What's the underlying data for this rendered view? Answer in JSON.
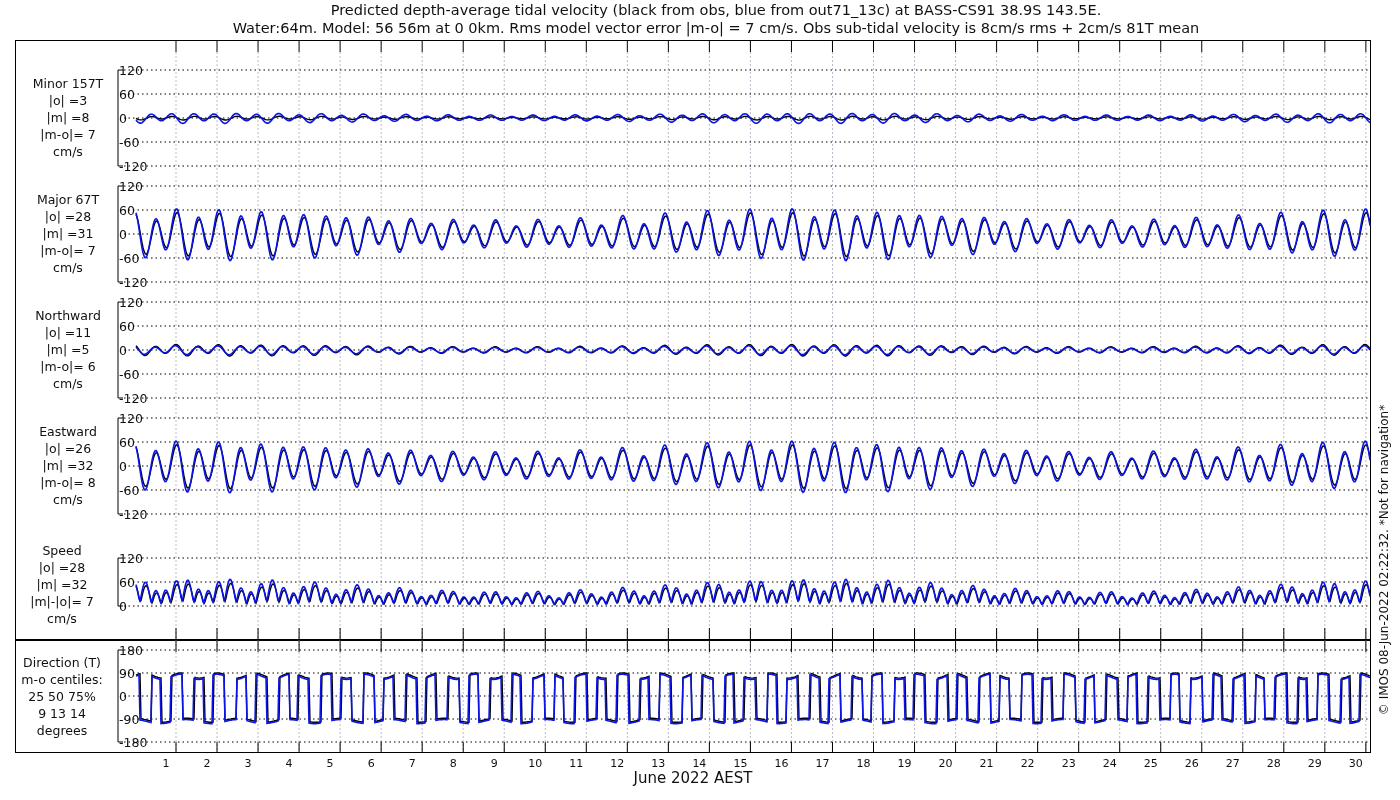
{
  "title_lines": [
    "Predicted depth-average tidal velocity (black from obs, blue from out71_13c) at BASS-CS91 38.9S 143.5E.",
    "Water:64m. Model: 56 56m at 0 0km. Rms model vector error |m-o| = 7 cm/s. Obs sub-tidal velocity is 8cm/s rms + 2cm/s 81T mean"
  ],
  "panels": [
    {
      "kind": "minor",
      "label_lines": [
        "Minor 157T",
        "|o| =3",
        "|m| =8",
        "|m-o|= 7",
        "cm/s"
      ],
      "yticks": [
        "120",
        "60",
        "0",
        "-60",
        "-120"
      ]
    },
    {
      "kind": "major",
      "label_lines": [
        "Major 67T",
        "|o| =28",
        "|m| =31",
        "|m-o|= 7",
        "cm/s"
      ],
      "yticks": [
        "120",
        "60",
        "0",
        "-60",
        "-120"
      ]
    },
    {
      "kind": "northward",
      "label_lines": [
        "Northward",
        "|o| =11",
        "|m| =5",
        "|m-o|= 6",
        "cm/s"
      ],
      "yticks": [
        "120",
        "60",
        "0",
        "-60",
        "-120"
      ]
    },
    {
      "kind": "eastward",
      "label_lines": [
        "Eastward",
        "|o| =26",
        "|m| =32",
        "|m-o|= 8",
        "cm/s"
      ],
      "yticks": [
        "120",
        "60",
        "0",
        "-60",
        "-120"
      ]
    },
    {
      "kind": "speed",
      "label_lines": [
        "Speed",
        "|o| =28",
        "|m| =32",
        "|m|-|o|= 7",
        "cm/s"
      ],
      "yticks": [
        "120",
        "60",
        "0"
      ]
    },
    {
      "kind": "direction",
      "label_lines": [
        "Direction (T)",
        "m-o centiles:",
        "25  50  75%",
        "9  13  14",
        "degrees"
      ],
      "yticks": [
        "180",
        "90",
        "0",
        "-90",
        "-180"
      ]
    }
  ],
  "x_axis": {
    "day_labels": [
      "1",
      "2",
      "3",
      "4",
      "5",
      "6",
      "7",
      "8",
      "9",
      "10",
      "11",
      "12",
      "13",
      "14",
      "15",
      "16",
      "17",
      "18",
      "19",
      "20",
      "21",
      "22",
      "23",
      "24",
      "25",
      "26",
      "27",
      "28",
      "29",
      "30"
    ],
    "label": "June 2022 AEST"
  },
  "footer_note": "© IMOS 08-Jun-2022 02:22:32. *Not for navigation*"
}
